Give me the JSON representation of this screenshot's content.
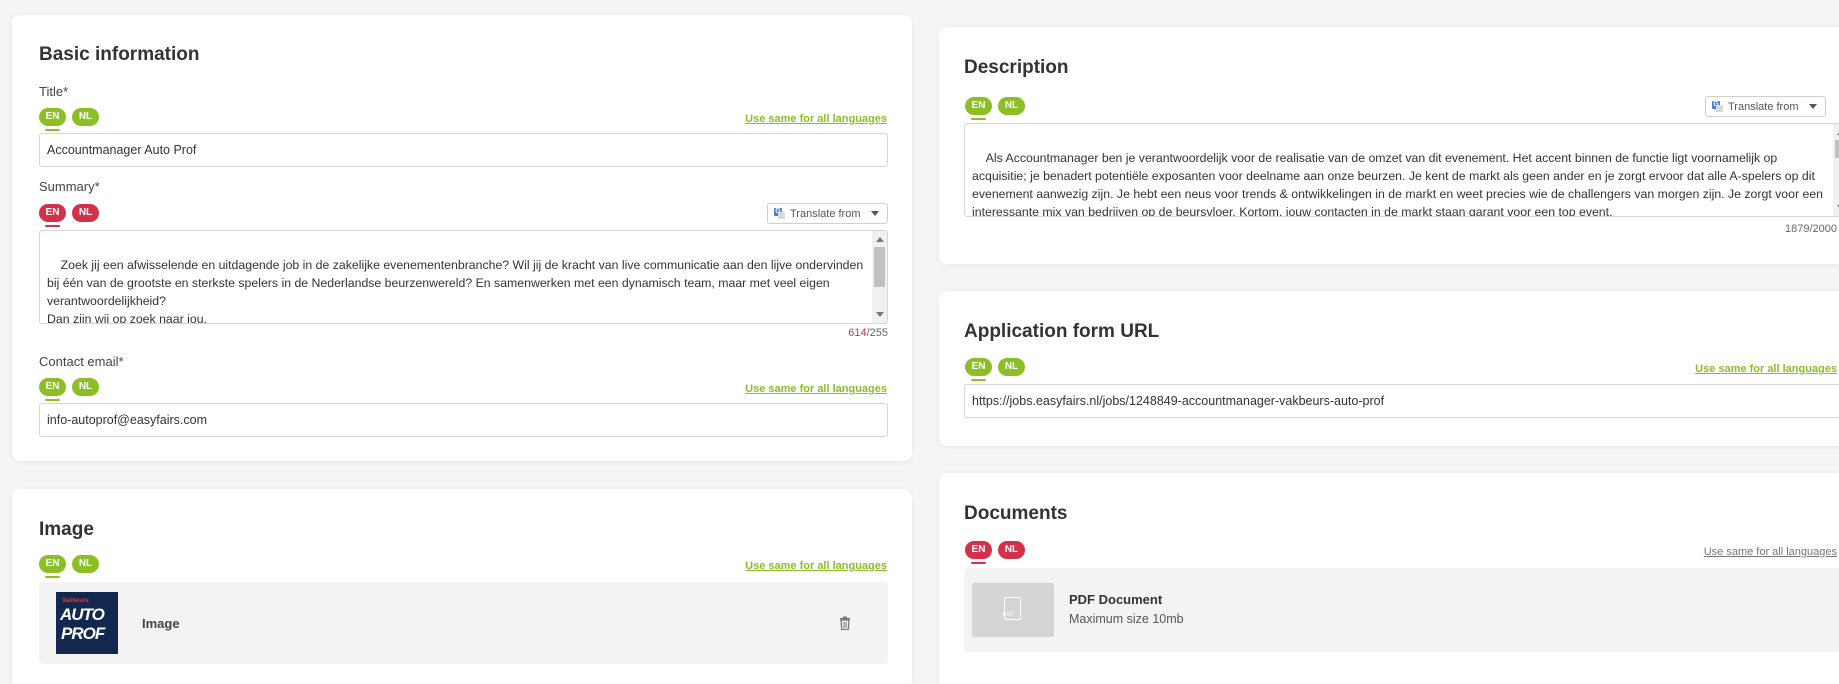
{
  "languages": {
    "en": "EN",
    "nl": "NL"
  },
  "use_same_label": "Use same for all languages",
  "translate_label": "Translate from",
  "basic_info": {
    "title": "Basic information",
    "title_label": "Title*",
    "title_value": "Accountmanager Auto Prof",
    "summary_label": "Summary*",
    "summary_text": "Zoek jij een afwisselende en uitdagende job in de zakelijke evenementenbranche? Wil jij de kracht van live communicatie aan den lijve ondervinden bij één van de grootste en sterkste spelers in de Nederlandse beurzenwereld? En samenwerken met een dynamisch team, maar met veel eigen verantwoordelijkheid?\nDan zijn wij op zoek naar jou.",
    "summary_count": "614",
    "summary_max": "/255",
    "contact_label": "Contact email*",
    "contact_value": "info-autoprof@easyfairs.com"
  },
  "image_section": {
    "title": "Image",
    "thumb_small": "Vakbeurs",
    "thumb_line1": "AUTO",
    "thumb_line2": "PROF",
    "item_label": "Image"
  },
  "description": {
    "title": "Description",
    "text": "Als Accountmanager ben je verantwoordelijk voor de realisatie van de omzet van dit evenement. Het accent binnen de functie ligt voornamelijk op acquisitie; je benadert potentiële exposanten voor deelname aan onze beurzen. Je kent de markt als geen ander en je zorgt ervoor dat alle A-spelers op dit evenement aanwezig zijn. Je hebt een neus voor trends & ontwikkelingen in de markt en weet precies wie de challengers van morgen zijn. Je zorgt voor een interessante mix van bedrijven op de beursvloer. Kortom, jouw contacten in de markt staan garant voor een top event.",
    "count": "1879/2000"
  },
  "application": {
    "title": "Application form URL",
    "url": "https://jobs.easyfairs.nl/jobs/1248849-accountmanager-vakbeurs-auto-prof"
  },
  "documents": {
    "title": "Documents",
    "pdf_icon_text": "PDF",
    "doc_title": "PDF Document",
    "doc_sub": "Maximum size 10mb"
  }
}
